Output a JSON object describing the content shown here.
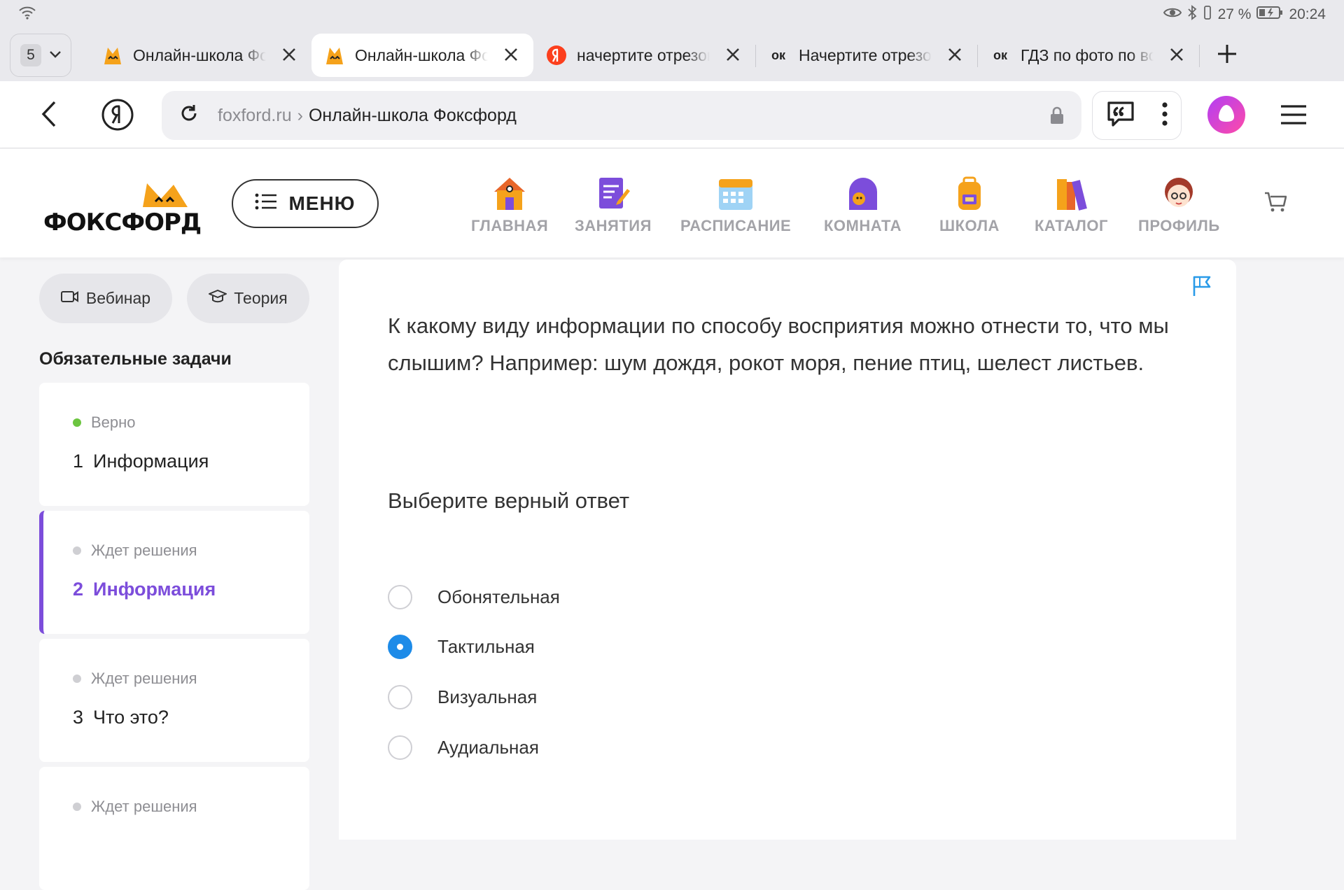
{
  "status": {
    "battery": "27 %",
    "time": "20:24"
  },
  "tabs": {
    "count": "5",
    "items": [
      {
        "title": "Онлайн-школа Фоксфорд",
        "icon": "foxford-favicon"
      },
      {
        "title": "Онлайн-школа Фоксфорд",
        "icon": "foxford-favicon",
        "active": true
      },
      {
        "title": "начертите отрезок",
        "icon": "yandex-favicon"
      },
      {
        "title": "Начертите отрезок",
        "icon": "ok-favicon",
        "badge": "ок"
      },
      {
        "title": "ГДЗ по фото по всем",
        "icon": "ok-favicon",
        "badge": "ок"
      }
    ]
  },
  "address": {
    "domain": "foxford.ru",
    "separator": "›",
    "page_title": "Онлайн-школа Фоксфорд"
  },
  "site": {
    "logo_text": "ФОКСФОРД",
    "menu_label": "МЕНЮ",
    "nav": [
      {
        "label": "ГЛАВНАЯ",
        "icon": "home-icon"
      },
      {
        "label": "ЗАНЯТИЯ",
        "icon": "lessons-icon"
      },
      {
        "label": "РАСПИСАНИЕ",
        "icon": "calendar-icon"
      },
      {
        "label": "КОМНАТА",
        "icon": "room-icon"
      },
      {
        "label": "ШКОЛА",
        "icon": "school-icon"
      },
      {
        "label": "КАТАЛОГ",
        "icon": "catalog-icon"
      },
      {
        "label": "ПРОФИЛЬ",
        "icon": "profile-icon"
      }
    ]
  },
  "sidebar": {
    "webinar_label": "Вебинар",
    "theory_label": "Теория",
    "section_title": "Обязательные задачи",
    "tasks": [
      {
        "status": "Верно",
        "num": "1",
        "name": "Информация"
      },
      {
        "status": "Ждет решения",
        "num": "2",
        "name": "Информация"
      },
      {
        "status": "Ждет решения",
        "num": "3",
        "name": "Что это?"
      },
      {
        "status": "Ждет решения",
        "num": "",
        "name": ""
      }
    ]
  },
  "task": {
    "question": "К какому виду информации по способу восприятия можно отнести то, что мы слышим? Например: шум дождя, рокот моря, пение птиц, шелест листьев.",
    "prompt": "Выберите верный ответ",
    "options": [
      "Обонятельная",
      "Тактильная",
      "Визуальная",
      "Аудиальная"
    ],
    "selected": "Тактильная"
  },
  "colors": {
    "accent_purple": "#7c4ddb",
    "radio_blue": "#1d8be8",
    "success_green": "#6cc540",
    "alice_pink": "#e63fd6"
  }
}
